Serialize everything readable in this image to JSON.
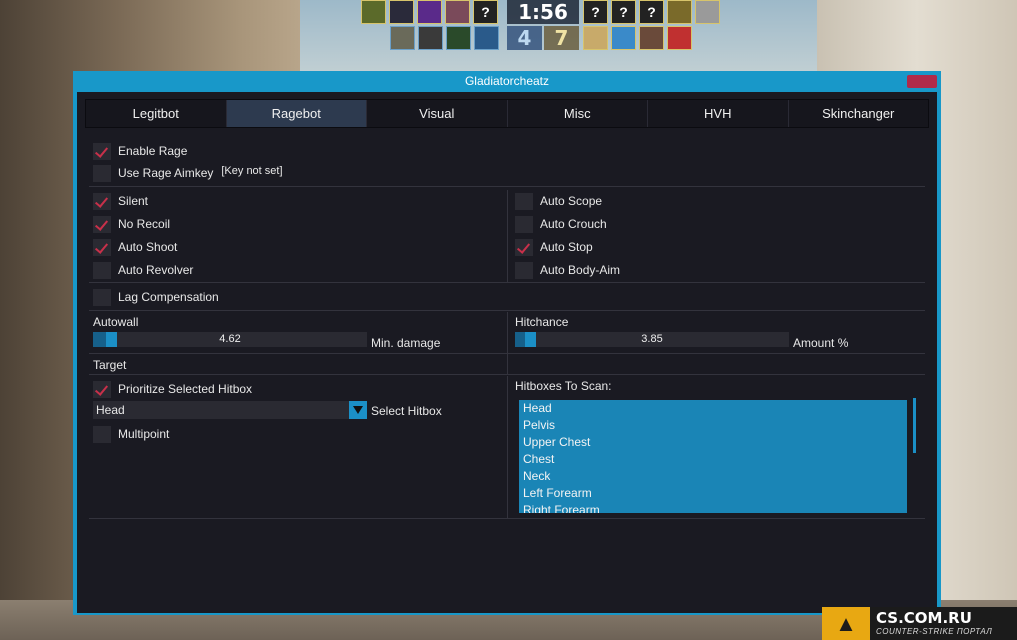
{
  "hud": {
    "timer": "1:56",
    "score_ct": "4",
    "score_t": "7",
    "unknown_avatar_glyph": "?"
  },
  "window": {
    "title": "Gladiatorcheatz"
  },
  "tabs": [
    {
      "label": "Legitbot"
    },
    {
      "label": "Ragebot",
      "active": true
    },
    {
      "label": "Visual"
    },
    {
      "label": "Misc"
    },
    {
      "label": "HVH"
    },
    {
      "label": "Skinchanger"
    }
  ],
  "rage": {
    "enable_label": "Enable Rage",
    "enable_checked": true,
    "aimkey_label": "Use Rage Aimkey",
    "aimkey_checked": false,
    "aimkey_value": "[Key not set]"
  },
  "options_left": [
    {
      "label": "Silent",
      "checked": true
    },
    {
      "label": "No Recoil",
      "checked": true
    },
    {
      "label": "Auto Shoot",
      "checked": true
    },
    {
      "label": "Auto Revolver",
      "checked": false
    }
  ],
  "options_right": [
    {
      "label": "Auto Scope",
      "checked": false
    },
    {
      "label": "Auto Crouch",
      "checked": false
    },
    {
      "label": "Auto Stop",
      "checked": true
    },
    {
      "label": "Auto Body-Aim",
      "checked": false
    }
  ],
  "lag_comp": {
    "label": "Lag Compensation",
    "checked": false
  },
  "autowall": {
    "title": "Autowall",
    "value": "4.62",
    "label": "Min. damage",
    "fraction": 0.046
  },
  "hitchance": {
    "title": "Hitchance",
    "value": "3.85",
    "label": "Amount %",
    "fraction": 0.038
  },
  "target": {
    "title": "Target",
    "prioritize_label": "Prioritize Selected Hitbox",
    "prioritize_checked": true,
    "hitbox_value": "Head",
    "hitbox_label": "Select Hitbox",
    "multipoint_label": "Multipoint",
    "multipoint_checked": false
  },
  "hitboxes": {
    "title": "Hitboxes To Scan:",
    "items": [
      "Head",
      "Pelvis",
      "Upper Chest",
      "Chest",
      "Neck",
      "Left Forearm",
      "Right Forearm"
    ]
  },
  "badge": {
    "title": "CS.COM.RU",
    "subtitle": "COUNTER-STRIKE ПОРТАЛ"
  },
  "colors": {
    "accent": "#1898c9",
    "check": "#c8304a",
    "background": "#1a1a22"
  }
}
